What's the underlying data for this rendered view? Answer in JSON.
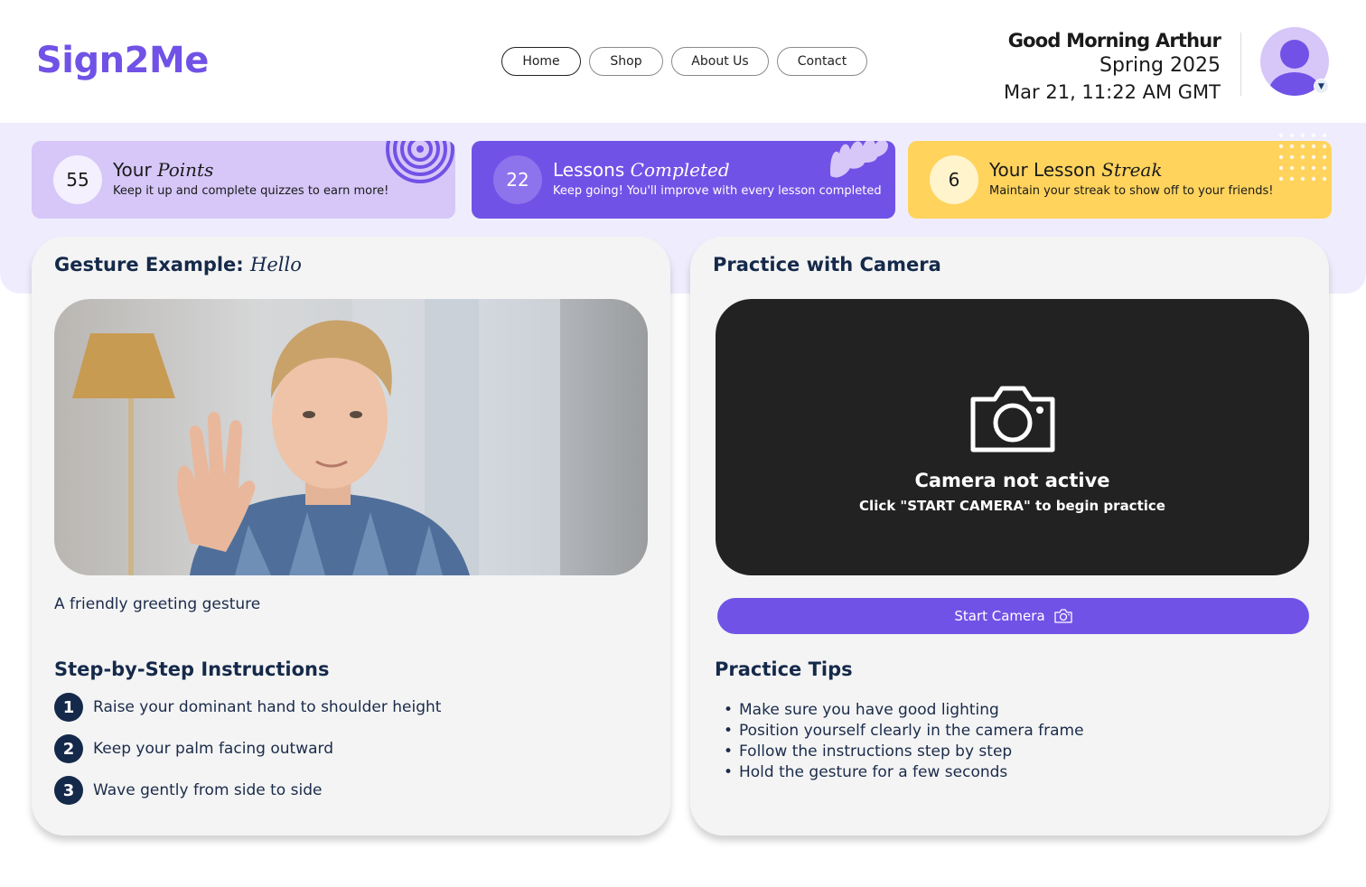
{
  "brand": {
    "logo": "Sign2Me",
    "accent": "#7152e6"
  },
  "nav": {
    "items": [
      "Home",
      "Shop",
      "About Us",
      "Contact"
    ],
    "active": "Home"
  },
  "greeting": {
    "name": "Good Morning Arthur",
    "semester": "Spring 2025",
    "datetime": "Mar 21, 11:22 AM GMT"
  },
  "profile": {
    "avatar_icon": "user-avatar-icon",
    "caret_icon": "chevron-down-icon"
  },
  "stats": {
    "points": {
      "value": "55",
      "title_plain": "Your",
      "title_em": "Points",
      "subtitle": "Keep it up and complete quizzes to earn more!"
    },
    "lessons": {
      "value": "22",
      "title_plain": "Lessons",
      "title_em": "Completed",
      "subtitle": "Keep going! You'll improve with every lesson completed"
    },
    "streak": {
      "value": "6",
      "title_plain": "Your Lesson",
      "title_em": "Streak",
      "subtitle": "Maintain your streak to show off to your friends!"
    }
  },
  "gesture": {
    "title_prefix": "Gesture Example:",
    "title_em": "Hello",
    "caption": "A friendly greeting gesture",
    "instructions_title": "Step-by-Step Instructions",
    "steps": [
      {
        "num": "1",
        "text": "Raise your dominant hand to shoulder height"
      },
      {
        "num": "2",
        "text": "Keep your palm facing outward"
      },
      {
        "num": "3",
        "text": "Wave gently from side to side"
      }
    ]
  },
  "practice": {
    "title": "Practice with Camera",
    "camera_status": "Camera not active",
    "camera_hint": "Click \"START CAMERA\" to begin practice",
    "start_button": "Start Camera",
    "tips_title": "Practice Tips",
    "tips": [
      "Make sure you have good lighting",
      "Position yourself clearly in the camera frame",
      "Follow the instructions step by step",
      "Hold the gesture for a few seconds"
    ]
  }
}
